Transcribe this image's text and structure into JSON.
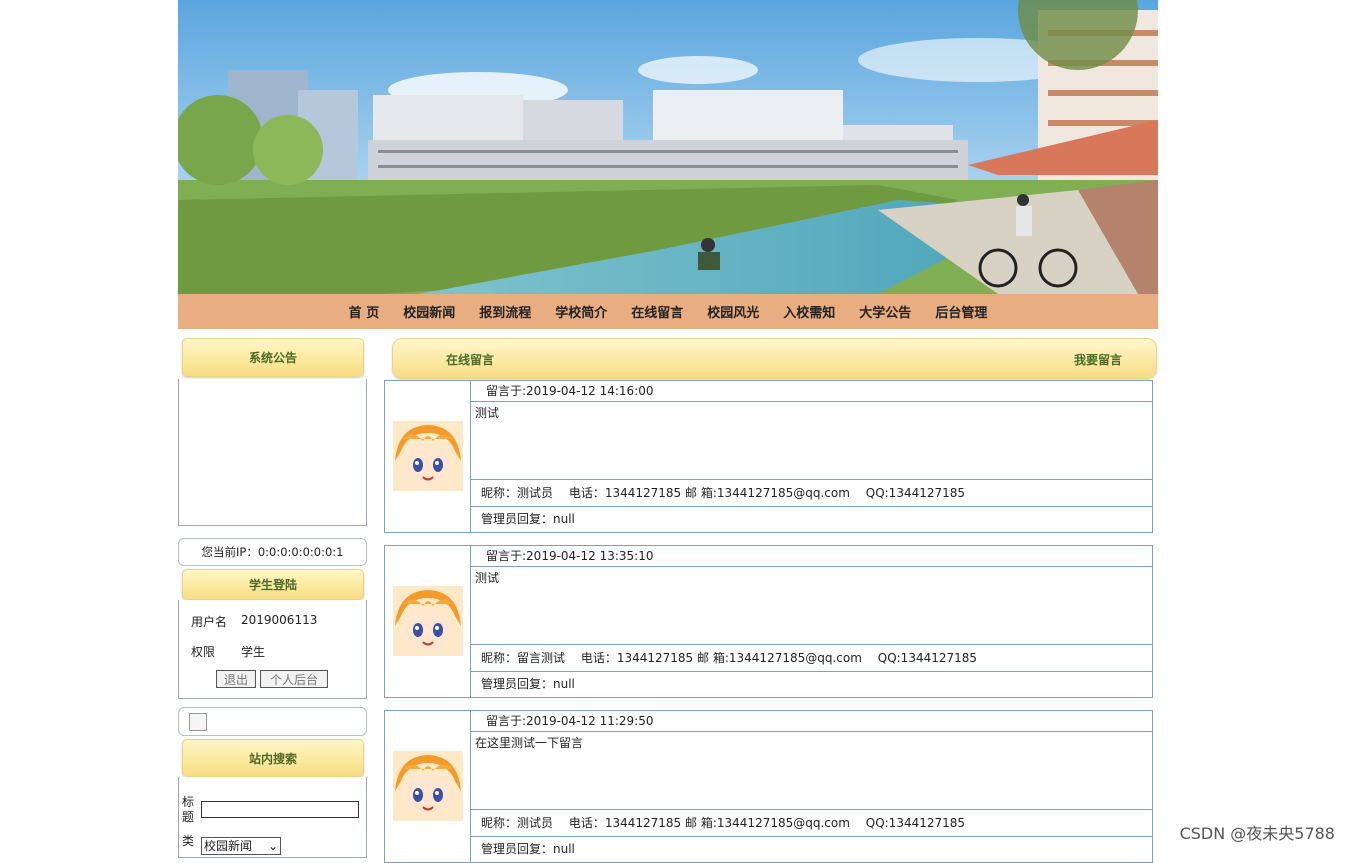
{
  "nav": {
    "items": [
      "首 页",
      "校园新闻",
      "报到流程",
      "学校简介",
      "在线留言",
      "校园风光",
      "入校需知",
      "大学公告",
      "后台管理"
    ]
  },
  "sidebar": {
    "notice_title": "系统公告",
    "ip_text": "您当前IP：0:0:0:0:0:0:0:1",
    "login_title": "学生登陆",
    "username_label": "用户名",
    "username_value": "2019006113",
    "role_label": "权限",
    "role_value": "学生",
    "logout_button": "退出",
    "profile_button": "个人后台",
    "search_title": "站内搜索",
    "search_title_label": "标\n题",
    "search_type_label": "类",
    "search_type_value": "校园新闻"
  },
  "main": {
    "title": "在线留言",
    "action": "我要留言",
    "messages": [
      {
        "time": "留言于:2019-04-12 14:16:00",
        "content": "测试",
        "nick": "昵称：测试员",
        "phone": "电话：1344127185",
        "email": "邮 箱:1344127185@qq.com",
        "qq": "QQ:1344127185",
        "reply": "管理员回复：null"
      },
      {
        "time": "留言于:2019-04-12 13:35:10",
        "content": "测试",
        "nick": "昵称：留言测试",
        "phone": "电话：1344127185",
        "email": "邮 箱:1344127185@qq.com",
        "qq": "QQ:1344127185",
        "reply": "管理员回复：null"
      },
      {
        "time": "留言于:2019-04-12 11:29:50",
        "content": "在这里测试一下留言",
        "nick": "昵称：测试员",
        "phone": "电话：1344127185",
        "email": "邮 箱:1344127185@qq.com",
        "qq": "QQ:1344127185",
        "reply": "管理员回复：null"
      }
    ]
  },
  "watermark": "CSDN @夜未央5788",
  "colors": {
    "nav_bg": "#e8ad80",
    "tab_gold": "#fbe89a",
    "label_green": "#4d6a2a",
    "border_blue": "#7da0c6"
  }
}
